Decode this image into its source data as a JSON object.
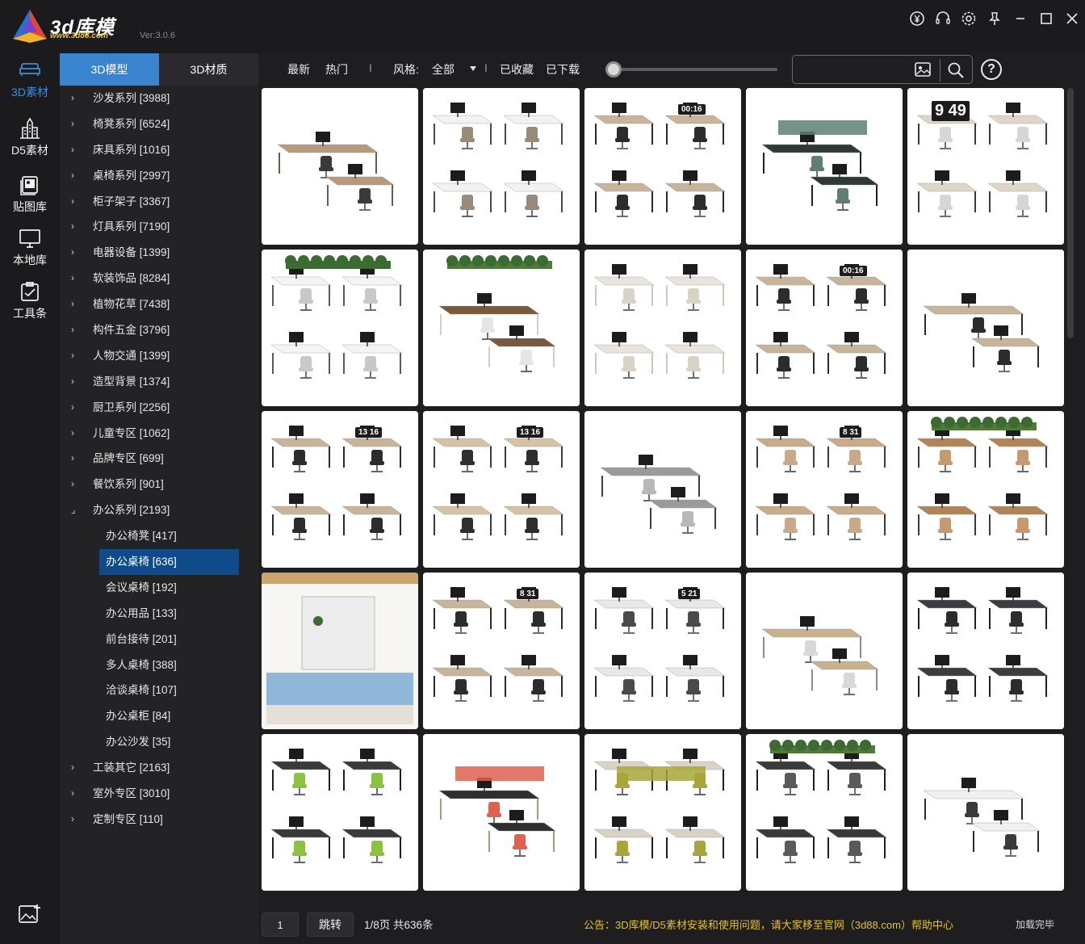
{
  "app": {
    "brand": "3d库模",
    "brand_url": "www.3d88.com",
    "version": "Ver:3.0.6"
  },
  "window_controls": [
    "currency-icon",
    "headset-icon",
    "settings-icon",
    "pin-icon",
    "minimize-icon",
    "maximize-icon",
    "close-icon"
  ],
  "rail": [
    {
      "label": "3D素材",
      "icon": "sofa-icon",
      "active": true
    },
    {
      "label": "D5素材",
      "icon": "building-icon",
      "active": false
    },
    {
      "label": "贴图库",
      "icon": "texture-icon",
      "active": false
    },
    {
      "label": "本地库",
      "icon": "monitor-icon",
      "active": false
    },
    {
      "label": "工具条",
      "icon": "toolbox-icon",
      "active": false
    }
  ],
  "tabs": [
    {
      "label": "3D模型",
      "active": true
    },
    {
      "label": "3D材质",
      "active": false
    }
  ],
  "tree": [
    {
      "label": "沙发系列 [3988]",
      "level": 0,
      "arrow": "›"
    },
    {
      "label": "椅凳系列 [6524]",
      "level": 0,
      "arrow": "›"
    },
    {
      "label": "床具系列 [1016]",
      "level": 0,
      "arrow": "›"
    },
    {
      "label": "桌椅系列 [2997]",
      "level": 0,
      "arrow": "›"
    },
    {
      "label": "柜子架子 [3367]",
      "level": 0,
      "arrow": "›"
    },
    {
      "label": "灯具系列 [7190]",
      "level": 0,
      "arrow": "›"
    },
    {
      "label": "电器设备 [1399]",
      "level": 0,
      "arrow": "›"
    },
    {
      "label": "软装饰品 [8284]",
      "level": 0,
      "arrow": "›"
    },
    {
      "label": "植物花草 [7438]",
      "level": 0,
      "arrow": "›"
    },
    {
      "label": "构件五金 [3796]",
      "level": 0,
      "arrow": "›"
    },
    {
      "label": "人物交通 [1399]",
      "level": 0,
      "arrow": "›"
    },
    {
      "label": "造型背景 [1374]",
      "level": 0,
      "arrow": "›"
    },
    {
      "label": "厨卫系列 [2256]",
      "level": 0,
      "arrow": "›"
    },
    {
      "label": "儿童专区 [1062]",
      "level": 0,
      "arrow": "›"
    },
    {
      "label": "品牌专区 [699]",
      "level": 0,
      "arrow": "›"
    },
    {
      "label": "餐饮系列 [901]",
      "level": 0,
      "arrow": "›"
    },
    {
      "label": "办公系列 [2193]",
      "level": 0,
      "arrow": "⌟"
    },
    {
      "label": "办公椅凳 [417]",
      "level": 1,
      "arrow": ""
    },
    {
      "label": "办公桌椅 [636]",
      "level": 1,
      "arrow": "",
      "selected": true
    },
    {
      "label": "会议桌椅 [192]",
      "level": 1,
      "arrow": ""
    },
    {
      "label": "办公用品 [133]",
      "level": 1,
      "arrow": ""
    },
    {
      "label": "前台接待 [201]",
      "level": 1,
      "arrow": ""
    },
    {
      "label": "多人桌椅 [388]",
      "level": 1,
      "arrow": ""
    },
    {
      "label": "洽谈桌椅 [107]",
      "level": 1,
      "arrow": ""
    },
    {
      "label": "办公桌柜 [84]",
      "level": 1,
      "arrow": ""
    },
    {
      "label": "办公沙发 [35]",
      "level": 1,
      "arrow": ""
    },
    {
      "label": "工装其它 [2163]",
      "level": 0,
      "arrow": "›"
    },
    {
      "label": "室外专区 [3010]",
      "level": 0,
      "arrow": "›"
    },
    {
      "label": "定制专区 [110]",
      "level": 0,
      "arrow": "›"
    }
  ],
  "toolbar": {
    "latest": "最新",
    "hot": "热门",
    "sep1": "I",
    "style_label": "风格:",
    "style_value": "全部",
    "sep2": "I",
    "favorited": "已收藏",
    "downloaded": "已下载",
    "search_placeholder": "",
    "help": "?"
  },
  "grid": [
    {
      "variant": "desk-a",
      "screen": ""
    },
    {
      "variant": "desk-b",
      "screen": ""
    },
    {
      "variant": "workstations",
      "screen": "00:16"
    },
    {
      "variant": "green-pods",
      "screen": ""
    },
    {
      "variant": "clock",
      "screen": "9 49"
    },
    {
      "variant": "planters",
      "screen": ""
    },
    {
      "variant": "planters-b",
      "screen": ""
    },
    {
      "variant": "bench",
      "screen": ""
    },
    {
      "variant": "workstations",
      "screen": "00:16"
    },
    {
      "variant": "workstations",
      "screen": ""
    },
    {
      "variant": "workstations",
      "screen": "13 16"
    },
    {
      "variant": "modular",
      "screen": "13 16"
    },
    {
      "variant": "grey-office",
      "screen": ""
    },
    {
      "variant": "wood-panel",
      "screen": "8 31"
    },
    {
      "variant": "wood-desk",
      "screen": ""
    },
    {
      "variant": "topdown",
      "screen": ""
    },
    {
      "variant": "workstations",
      "screen": "8 31"
    },
    {
      "variant": "frame-shelf",
      "screen": "5 21"
    },
    {
      "variant": "single-desk",
      "screen": ""
    },
    {
      "variant": "dark-desk",
      "screen": ""
    },
    {
      "variant": "green-chairs",
      "screen": ""
    },
    {
      "variant": "red-panels",
      "screen": ""
    },
    {
      "variant": "olive-bench",
      "screen": ""
    },
    {
      "variant": "planter-desks",
      "screen": ""
    },
    {
      "variant": "wood-pods",
      "screen": ""
    }
  ],
  "bottom": {
    "page_value": "1",
    "jump_label": "跳转",
    "page_info": "1/8页 共636条",
    "notice": "公告：3D库模/D5素材安装和使用问题，请大家移至官网（3d88.com）帮助中心",
    "loaded": "加载完毕"
  },
  "colors": {
    "accent": "#3a84cf",
    "selected": "#0f4a8a",
    "notice": "#e6c229",
    "background": "#1e1e21"
  }
}
